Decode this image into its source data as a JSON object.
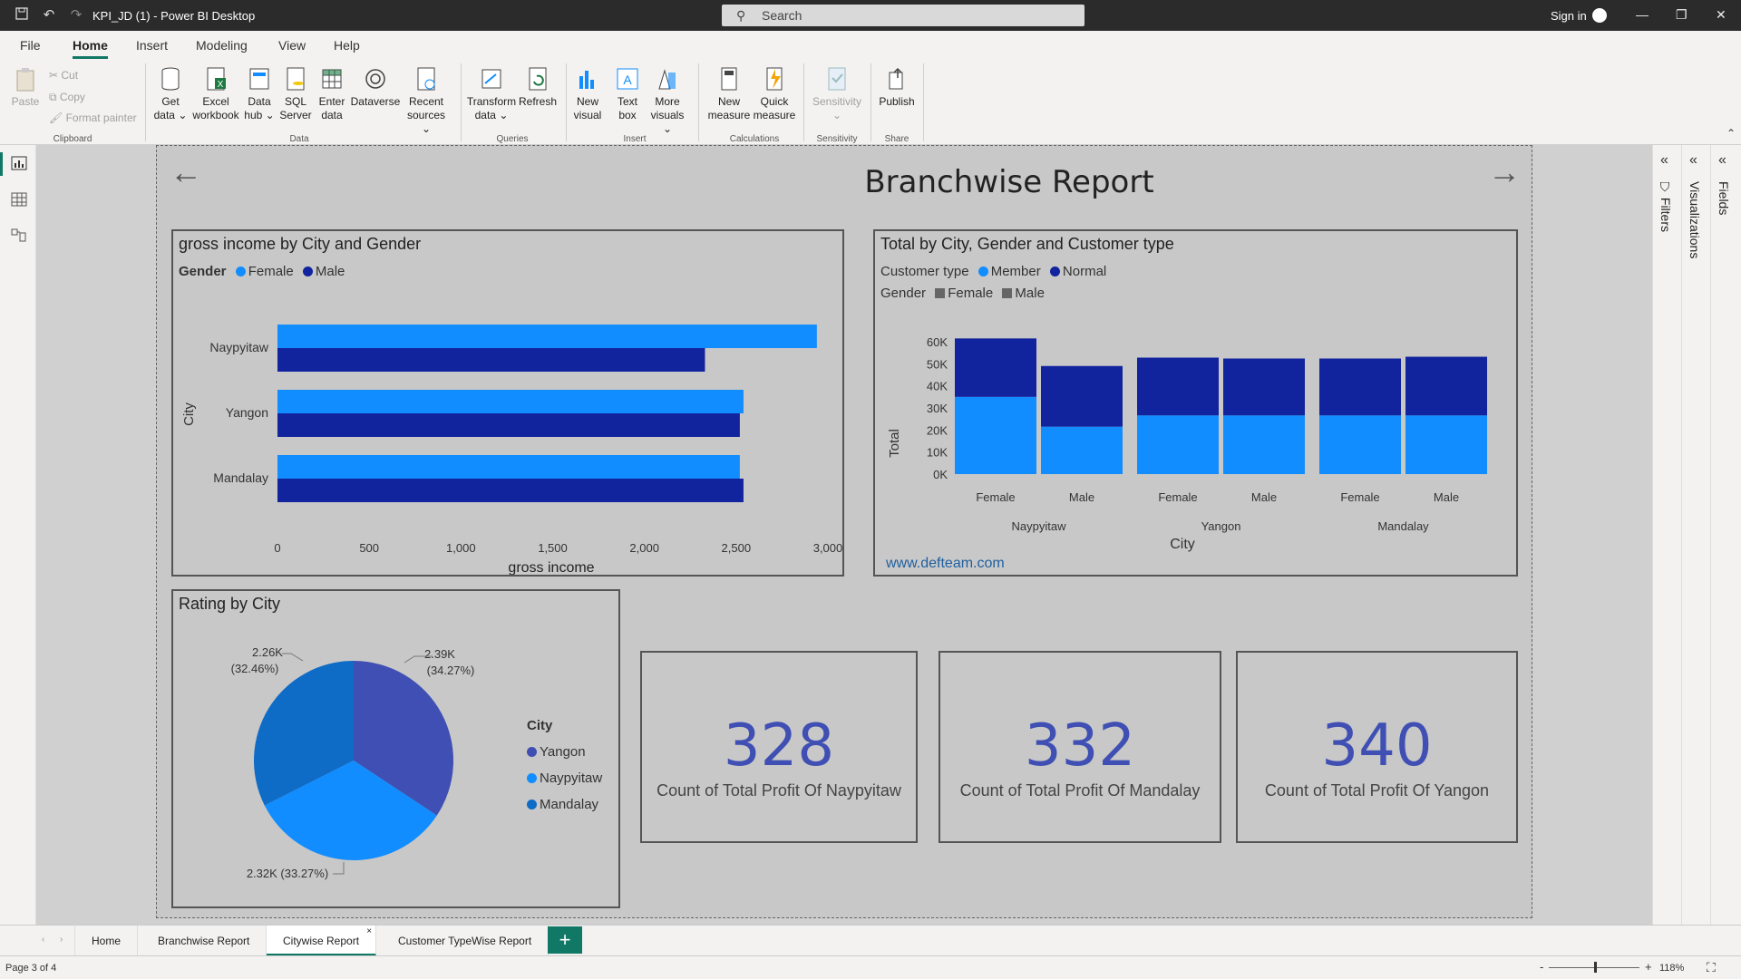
{
  "app": {
    "window_title": "KPI_JD (1) - Power BI Desktop",
    "search_placeholder": "Search",
    "sign_in": "Sign in"
  },
  "menu": {
    "tabs": [
      "File",
      "Home",
      "Insert",
      "Modeling",
      "View",
      "Help"
    ],
    "active": "Home"
  },
  "ribbon": {
    "clipboard": {
      "paste": "Paste",
      "cut": "Cut",
      "copy": "Copy",
      "format_painter": "Format painter",
      "group": "Clipboard"
    },
    "data": {
      "get_data": [
        "Get",
        "data ⌄"
      ],
      "excel": [
        "Excel",
        "workbook"
      ],
      "data_hub": [
        "Data",
        "hub ⌄"
      ],
      "sql": [
        "SQL",
        "Server"
      ],
      "enter": [
        "Enter",
        "data"
      ],
      "dataverse": [
        "Dataverse",
        ""
      ],
      "recent": [
        "Recent",
        "sources ⌄"
      ],
      "group": "Data"
    },
    "queries": {
      "transform": [
        "Transform",
        "data ⌄"
      ],
      "refresh": [
        "Refresh",
        ""
      ],
      "group": "Queries"
    },
    "insert": {
      "new_visual": [
        "New",
        "visual"
      ],
      "text_box": [
        "Text",
        "box"
      ],
      "more_visuals": [
        "More",
        "visuals ⌄"
      ],
      "group": "Insert"
    },
    "calculations": {
      "new_measure": [
        "New",
        "measure"
      ],
      "quick_measure": [
        "Quick",
        "measure"
      ],
      "group": "Calculations"
    },
    "sensitivity": {
      "label": [
        "Sensitivity",
        "⌄"
      ],
      "group": "Sensitivity"
    },
    "share": {
      "publish": [
        "Publish",
        ""
      ],
      "group": "Share"
    }
  },
  "report": {
    "title": "Branchwise Report",
    "bar_chart": {
      "title": "gross income by City and Gender",
      "legend_title": "Gender",
      "legend_items": [
        "Female",
        "Male"
      ],
      "y_axis_label": "City",
      "x_axis_label": "gross income",
      "x_ticks": [
        "0",
        "500",
        "1,000",
        "1,500",
        "2,000",
        "2,500",
        "3,000"
      ]
    },
    "column_chart": {
      "title": "Total by City, Gender and Customer type",
      "legend1_title": "Customer type",
      "legend1_items": [
        "Member",
        "Normal"
      ],
      "legend2_title": "Gender",
      "legend2_items": [
        "Female",
        "Male"
      ],
      "y_axis_label": "Total",
      "x_axis_label": "City",
      "y_ticks": [
        "60K",
        "50K",
        "40K",
        "30K",
        "20K",
        "10K",
        "0K"
      ],
      "footer_link": "www.defteam.com"
    },
    "pie_chart": {
      "title": "Rating by City",
      "legend_title": "City",
      "legend_items": [
        "Yangon",
        "Naypyitaw",
        "Mandalay"
      ],
      "labels": {
        "yangon": [
          "2.39K",
          "(34.27%)"
        ],
        "mandalay": [
          "2.26K",
          "(32.46%)"
        ],
        "naypyitaw": "2.32K (33.27%)"
      }
    },
    "cards": [
      {
        "value": "328",
        "label": "Count of Total Profit Of Naypyitaw"
      },
      {
        "value": "332",
        "label": "Count of Total Profit Of Mandalay"
      },
      {
        "value": "340",
        "label": "Count of Total Profit Of Yangon"
      }
    ]
  },
  "chart_data": [
    {
      "type": "bar",
      "orientation": "horizontal",
      "title": "gross income by City and Gender",
      "xlabel": "gross income",
      "ylabel": "City",
      "categories": [
        "Naypyitaw",
        "Yangon",
        "Mandalay"
      ],
      "series": [
        {
          "name": "Female",
          "values": [
            2940,
            2540,
            2520
          ],
          "color": "#118dff"
        },
        {
          "name": "Male",
          "values": [
            2330,
            2520,
            2540
          ],
          "color": "#12239e"
        }
      ],
      "xlim": [
        0,
        3000
      ]
    },
    {
      "type": "bar",
      "stacked": true,
      "title": "Total by City, Gender and Customer type",
      "ylabel": "Total",
      "xlabel": "City",
      "groups": [
        "Naypyitaw",
        "Yangon",
        "Mandalay"
      ],
      "categories": [
        "Female",
        "Male",
        "Female",
        "Male",
        "Female",
        "Male"
      ],
      "series": [
        {
          "name": "Member",
          "values": [
            35000,
            21500,
            26600,
            26600,
            26600,
            26600
          ],
          "color": "#118dff"
        },
        {
          "name": "Normal",
          "values": [
            26500,
            27500,
            26200,
            25800,
            25800,
            26600
          ],
          "color": "#12239e"
        }
      ],
      "ylim": [
        0,
        60000
      ]
    },
    {
      "type": "pie",
      "title": "Rating by City",
      "categories": [
        "Yangon",
        "Naypyitaw",
        "Mandalay"
      ],
      "values": [
        2390,
        2320,
        2260
      ],
      "percents": [
        34.27,
        33.27,
        32.46
      ],
      "colors": [
        "#3f4fb3",
        "#118dff",
        "#0e6bc6"
      ]
    }
  ],
  "page_tabs": {
    "tabs": [
      "Home",
      "Branchwise Report",
      "Citywise Report",
      "Customer TypeWise Report"
    ],
    "active": "Citywise Report",
    "add": "+"
  },
  "panes": {
    "filters": "Filters",
    "visualizations": "Visualizations",
    "fields": "Fields"
  },
  "status": {
    "page": "Page 3 of 4",
    "zoom": "118%"
  }
}
